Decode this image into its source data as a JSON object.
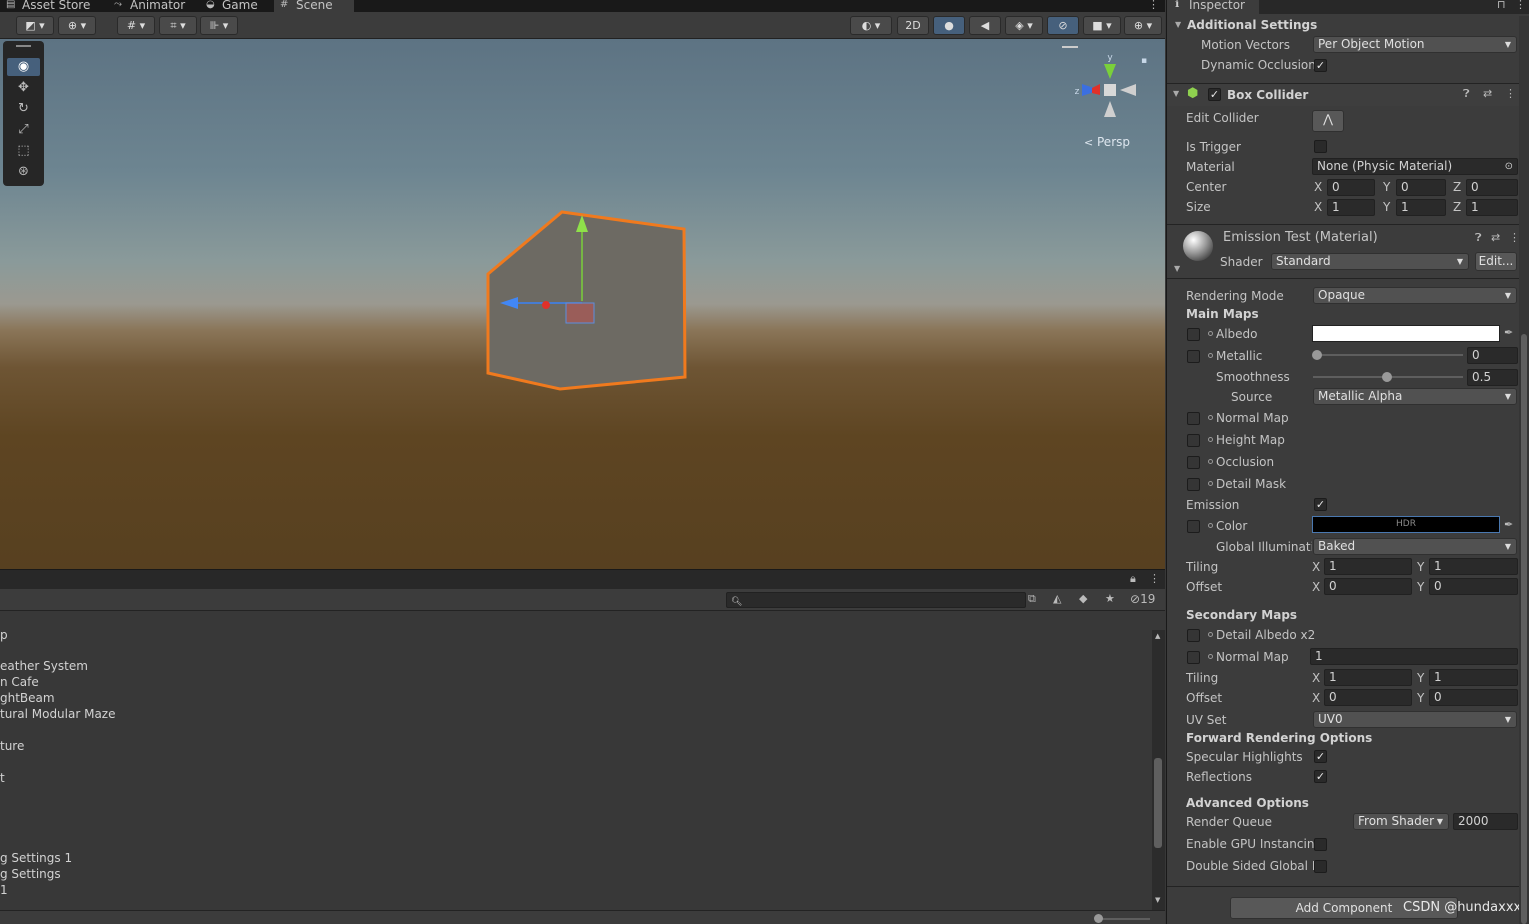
{
  "tabs": [
    {
      "label": "Asset Store",
      "icon": "store-icon"
    },
    {
      "label": "Animator",
      "icon": "animator-icon"
    },
    {
      "label": "Game",
      "icon": "gamepad-icon"
    },
    {
      "label": "Scene",
      "icon": "scene-icon"
    }
  ],
  "scene_toolbar": {
    "mode_2d": "2D"
  },
  "gizmo": {
    "persp_label": "Persp",
    "axis_x": "x",
    "axis_y": "y",
    "axis_z": "z"
  },
  "hierarchy": {
    "hidden_count": "19",
    "items": [
      "p",
      "eather System",
      "n Cafe",
      "ghtBeam",
      "tural Modular Maze",
      "ture",
      "t",
      "g Settings 1",
      "g Settings",
      "1"
    ]
  },
  "inspector": {
    "tab_label": "Inspector",
    "additional_settings": {
      "title": "Additional Settings",
      "motion_vectors_label": "Motion Vectors",
      "motion_vectors_value": "Per Object Motion",
      "dynamic_occlusion_label": "Dynamic Occlusion",
      "dynamic_occlusion_checked": "✓"
    },
    "box_collider": {
      "title": "Box Collider",
      "enabled": "✓",
      "edit_collider_label": "Edit Collider",
      "is_trigger_label": "Is Trigger",
      "material_label": "Material",
      "material_value": "None (Physic Material)",
      "center_label": "Center",
      "center": {
        "x": "0",
        "y": "0",
        "z": "0"
      },
      "size_label": "Size",
      "size": {
        "x": "1",
        "y": "1",
        "z": "1"
      }
    },
    "material": {
      "title": "Emission Test (Material)",
      "shader_label": "Shader",
      "shader_value": "Standard",
      "edit_button": "Edit...",
      "rendering_mode_label": "Rendering Mode",
      "rendering_mode_value": "Opaque",
      "main_maps_title": "Main Maps",
      "albedo_label": "Albedo",
      "metallic_label": "Metallic",
      "metallic_value": "0",
      "smoothness_label": "Smoothness",
      "smoothness_value": "0.5",
      "source_label": "Source",
      "source_value": "Metallic Alpha",
      "normal_map_label": "Normal Map",
      "height_map_label": "Height Map",
      "occlusion_label": "Occlusion",
      "detail_mask_label": "Detail Mask",
      "emission_label": "Emission",
      "emission_checked": "✓",
      "color_label": "Color",
      "hdr_label": "HDR",
      "gi_label": "Global Illuminatio",
      "gi_value": "Baked",
      "tiling_label": "Tiling",
      "tiling": {
        "x": "1",
        "y": "1"
      },
      "offset_label": "Offset",
      "offset": {
        "x": "0",
        "y": "0"
      },
      "secondary_maps_title": "Secondary Maps",
      "detail_albedo_label": "Detail Albedo x2",
      "normal_map2_label": "Normal Map",
      "normal_map2_value": "1",
      "tiling2": {
        "x": "1",
        "y": "1"
      },
      "offset2": {
        "x": "0",
        "y": "0"
      },
      "uv_set_label": "UV Set",
      "uv_set_value": "UV0",
      "forward_title": "Forward Rendering Options",
      "specular_label": "Specular Highlights",
      "specular_checked": "✓",
      "reflections_label": "Reflections",
      "reflections_checked": "✓",
      "advanced_title": "Advanced Options",
      "render_queue_label": "Render Queue",
      "render_queue_mode": "From Shader",
      "render_queue_value": "2000",
      "gpu_instancing_label": "Enable GPU Instancing",
      "double_sided_label": "Double Sided Global Ill"
    },
    "add_component": "Add Component",
    "watermark": "CSDN @hundaxxx"
  },
  "axis_labels": {
    "x": "X",
    "y": "Y",
    "z": "Z"
  }
}
